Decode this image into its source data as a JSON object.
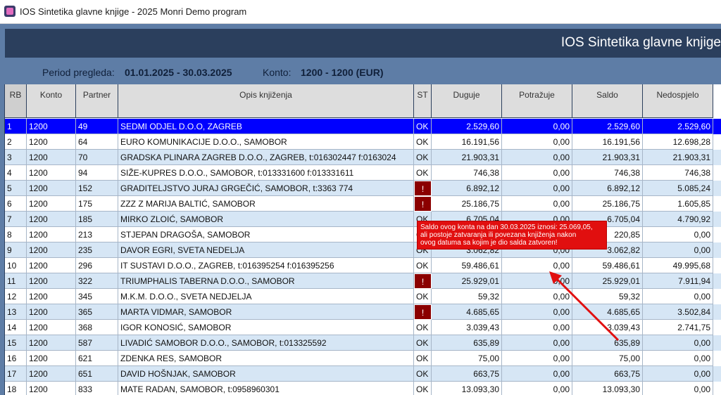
{
  "window": {
    "title": "IOS Sintetika glavne knjige - 2025 Monri Demo program"
  },
  "header": {
    "title": "IOS Sintetika glavne knjige"
  },
  "filters": {
    "period_label": "Period pregleda:",
    "period_value": "01.01.2025 - 30.03.2025",
    "konto_label": "Konto:",
    "konto_value": "1200 - 1200 (EUR)"
  },
  "columns": [
    "RB",
    "Konto",
    "Partner",
    "Opis knjiženja",
    "ST",
    "Duguje",
    "Potražuje",
    "Saldo",
    "Nedospjelo"
  ],
  "rows": [
    {
      "rb": "1",
      "konto": "1200",
      "partner": "49",
      "opis": "SEDMI ODJEL D.O.O, ZAGREB",
      "st": "OK",
      "duguje": "2.529,60",
      "potrazuje": "0,00",
      "saldo": "2.529,60",
      "nedospjelo": "2.529,60"
    },
    {
      "rb": "2",
      "konto": "1200",
      "partner": "64",
      "opis": "EURO KOMUNIKACIJE D.O.O., SAMOBOR",
      "st": "OK",
      "duguje": "16.191,56",
      "potrazuje": "0,00",
      "saldo": "16.191,56",
      "nedospjelo": "12.698,28"
    },
    {
      "rb": "3",
      "konto": "1200",
      "partner": "70",
      "opis": "GRADSKA PLINARA ZAGREB D.O.O., ZAGREB, t:016302447 f:0163024",
      "st": "OK",
      "duguje": "21.903,31",
      "potrazuje": "0,00",
      "saldo": "21.903,31",
      "nedospjelo": "21.903,31"
    },
    {
      "rb": "4",
      "konto": "1200",
      "partner": "94",
      "opis": "SIŽE-KUPRES D.O.O., SAMOBOR, t:013331600 f:013331611",
      "st": "OK",
      "duguje": "746,38",
      "potrazuje": "0,00",
      "saldo": "746,38",
      "nedospjelo": "746,38"
    },
    {
      "rb": "5",
      "konto": "1200",
      "partner": "152",
      "opis": "GRADITELJSTVO JURAJ GRGEČIĆ, SAMOBOR, t:3363 774",
      "st": "!",
      "duguje": "6.892,12",
      "potrazuje": "0,00",
      "saldo": "6.892,12",
      "nedospjelo": "5.085,24"
    },
    {
      "rb": "6",
      "konto": "1200",
      "partner": "175",
      "opis": "ZZZ Z MARIJA BALTIĆ, SAMOBOR",
      "st": "!",
      "duguje": "25.186,75",
      "potrazuje": "0,00",
      "saldo": "25.186,75",
      "nedospjelo": "1.605,85"
    },
    {
      "rb": "7",
      "konto": "1200",
      "partner": "185",
      "opis": "MIRKO ZLOIĆ, SAMOBOR",
      "st": "OK",
      "duguje": "6.705,04",
      "potrazuje": "0,00",
      "saldo": "6.705,04",
      "nedospjelo": "4.790,92"
    },
    {
      "rb": "8",
      "konto": "1200",
      "partner": "213",
      "opis": "STJEPAN DRAGOŠA, SAMOBOR",
      "st": "OK",
      "duguje": "",
      "potrazuje": "0,00",
      "saldo": "220,85",
      "nedospjelo": "0,00"
    },
    {
      "rb": "9",
      "konto": "1200",
      "partner": "235",
      "opis": "DAVOR EGRI, SVETA NEDELJA",
      "st": "OK",
      "duguje": "3.062,82",
      "potrazuje": "0,00",
      "saldo": "3.062,82",
      "nedospjelo": "0,00"
    },
    {
      "rb": "10",
      "konto": "1200",
      "partner": "296",
      "opis": "IT SUSTAVI D.O.O., ZAGREB, t:016395254 f:016395256",
      "st": "OK",
      "duguje": "59.486,61",
      "potrazuje": "0,00",
      "saldo": "59.486,61",
      "nedospjelo": "49.995,68"
    },
    {
      "rb": "11",
      "konto": "1200",
      "partner": "322",
      "opis": "TRIUMPHALIS TABERNA D.O.O., SAMOBOR",
      "st": "!",
      "duguje": "25.929,01",
      "potrazuje": "0,00",
      "saldo": "25.929,01",
      "nedospjelo": "7.911,94"
    },
    {
      "rb": "12",
      "konto": "1200",
      "partner": "345",
      "opis": "M.K.M. D.O.O., SVETA NEDJELJA",
      "st": "OK",
      "duguje": "59,32",
      "potrazuje": "0,00",
      "saldo": "59,32",
      "nedospjelo": "0,00"
    },
    {
      "rb": "13",
      "konto": "1200",
      "partner": "365",
      "opis": "MARTA VIDMAR, SAMOBOR",
      "st": "!",
      "duguje": "4.685,65",
      "potrazuje": "0,00",
      "saldo": "4.685,65",
      "nedospjelo": "3.502,84"
    },
    {
      "rb": "14",
      "konto": "1200",
      "partner": "368",
      "opis": "IGOR KONOSIĆ, SAMOBOR",
      "st": "OK",
      "duguje": "3.039,43",
      "potrazuje": "0,00",
      "saldo": "3.039,43",
      "nedospjelo": "2.741,75"
    },
    {
      "rb": "15",
      "konto": "1200",
      "partner": "587",
      "opis": "LIVADIĆ SAMOBOR D.O.O., SAMOBOR, t:013325592",
      "st": "OK",
      "duguje": "635,89",
      "potrazuje": "0,00",
      "saldo": "635,89",
      "nedospjelo": "0,00"
    },
    {
      "rb": "16",
      "konto": "1200",
      "partner": "621",
      "opis": "ZDENKA RES, SAMOBOR",
      "st": "OK",
      "duguje": "75,00",
      "potrazuje": "0,00",
      "saldo": "75,00",
      "nedospjelo": "0,00"
    },
    {
      "rb": "17",
      "konto": "1200",
      "partner": "651",
      "opis": "DAVID HOŠNJAK, SAMOBOR",
      "st": "OK",
      "duguje": "663,75",
      "potrazuje": "0,00",
      "saldo": "663,75",
      "nedospjelo": "0,00"
    },
    {
      "rb": "18",
      "konto": "1200",
      "partner": "833",
      "opis": "MATE RADAN, SAMOBOR, t:0958960301",
      "st": "OK",
      "duguje": "13.093,30",
      "potrazuje": "0,00",
      "saldo": "13.093,30",
      "nedospjelo": "0,00"
    }
  ],
  "tooltip": {
    "line1": "Saldo ovog konta na dan 30.03.2025 iznosi: 25.069,05,",
    "line2": "ali postoje zatvaranja ili povezana knjiženja nakon",
    "line3": "ovog datuma sa kojim je dio salda zatvoren!"
  },
  "colors": {
    "selected_row": "#0000ff",
    "alt_row": "#d6e6f5",
    "warning": "#8b0000",
    "tooltip": "#e10f0f"
  }
}
